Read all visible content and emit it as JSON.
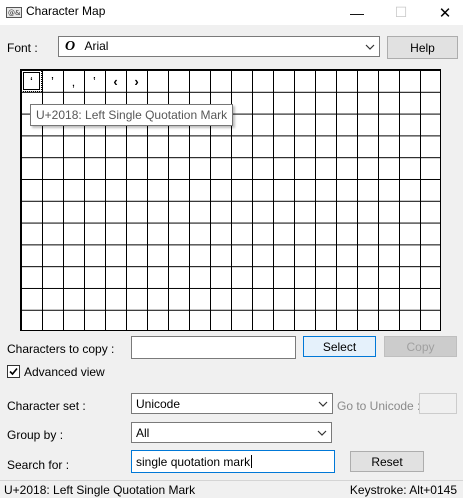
{
  "window": {
    "title": "Character Map",
    "minimize_glyph": "—",
    "maximize_glyph": "☐",
    "close_glyph": "✕"
  },
  "font": {
    "label": "Font :",
    "icon_glyph": "O",
    "value": "Arial",
    "help_label": "Help"
  },
  "grid": {
    "characters": [
      "‘",
      "’",
      "‚",
      "‛",
      "‹",
      "›"
    ],
    "selected_index": 0,
    "tooltip": "U+2018: Left Single Quotation Mark"
  },
  "copy": {
    "label": "Characters to copy :",
    "value": "",
    "select_label": "Select",
    "copy_label": "Copy"
  },
  "advanced": {
    "label": "Advanced view",
    "checked": true
  },
  "character_set": {
    "label": "Character set :",
    "value": "Unicode"
  },
  "goto_unicode": {
    "label": "Go to Unicode :",
    "value": ""
  },
  "group_by": {
    "label": "Group by :",
    "value": "All"
  },
  "search": {
    "label": "Search for :",
    "value": "single quotation mark",
    "reset_label": "Reset"
  },
  "status": {
    "left": "U+2018: Left Single Quotation Mark",
    "right": "Keystroke: Alt+0145"
  }
}
